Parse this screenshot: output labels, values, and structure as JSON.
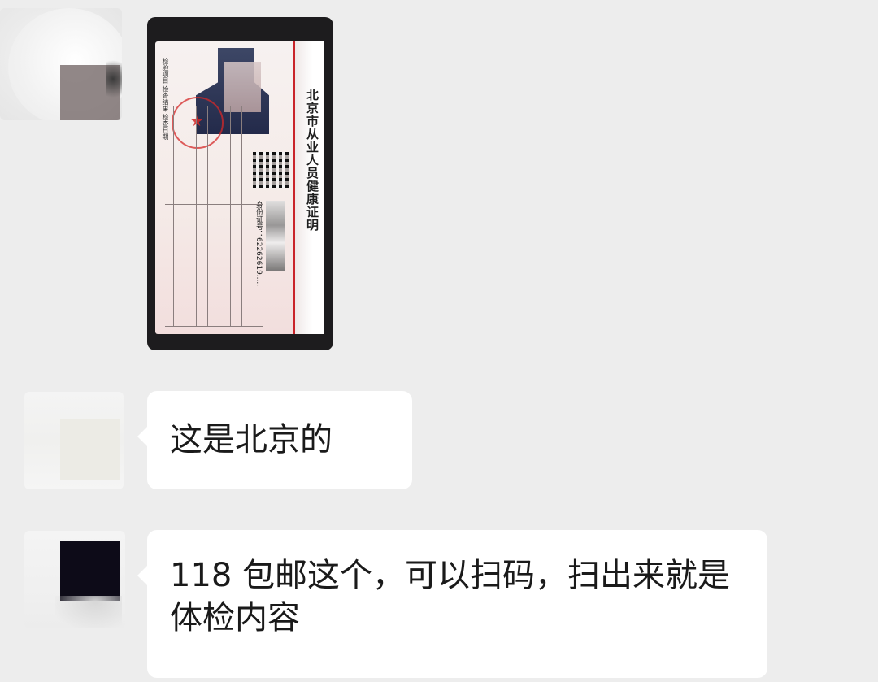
{
  "chat": {
    "messages": [
      {
        "type": "image",
        "image": {
          "card_title": "北京市从业人员健康证明",
          "id_label": "身份证号：",
          "id_number": "62262619.....",
          "side_text": "检验项目 检查结果 检查日期"
        }
      },
      {
        "type": "text",
        "text": "这是北京的"
      },
      {
        "type": "text",
        "text": "118 包邮这个，可以扫码，扫出来就是体检内容"
      }
    ]
  }
}
